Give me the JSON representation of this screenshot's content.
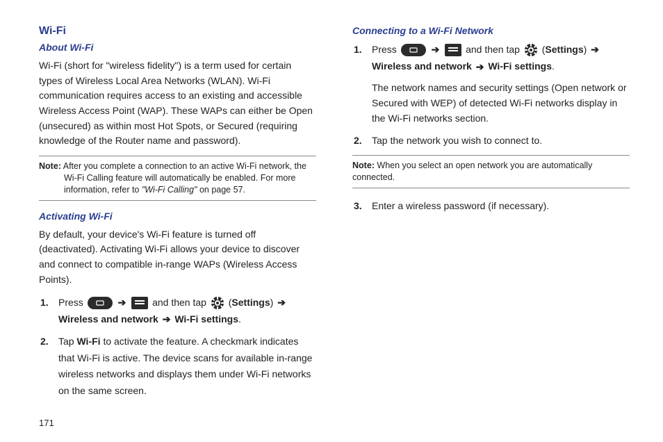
{
  "left": {
    "h1": "Wi-Fi",
    "about": {
      "heading": "About Wi-Fi",
      "body": "Wi-Fi (short for \"wireless fidelity\") is a term used for certain types of Wireless Local Area Networks (WLAN). Wi-Fi communication requires access to an existing and accessible Wireless Access Point (WAP). These WAPs can either be Open (unsecured) as within most Hot Spots, or Secured (requiring knowledge of the Router name and password)."
    },
    "note1": {
      "label": "Note:",
      "body": " After you complete a connection to an active Wi-Fi network, the Wi-Fi Calling feature will automatically be enabled. For more information, refer to ",
      "ref": "\"Wi-Fi Calling\"",
      "tail": "  on page 57."
    },
    "activating": {
      "heading": "Activating Wi-Fi",
      "body": "By default, your device's Wi-Fi feature is turned off (deactivated). Activating Wi-Fi allows your device to discover and connect to compatible in-range WAPs (Wireless Access Points).",
      "steps": [
        {
          "num": "1.",
          "pre": "Press ",
          "mid": " and then tap ",
          "settings": "Settings",
          "wn": "Wireless and network",
          "ws": "Wi-Fi settings"
        },
        {
          "num": "2.",
          "pre": "Tap ",
          "wifi": "Wi-Fi",
          "tail": " to activate the feature. A checkmark indicates that Wi-Fi is active. The device scans for available in-range wireless networks and displays them under Wi-Fi networks on the same screen."
        }
      ]
    }
  },
  "right": {
    "connecting": {
      "heading": "Connecting to a Wi-Fi Network",
      "steps": [
        {
          "num": "1.",
          "pre": "Press ",
          "mid": " and then tap ",
          "settings": "Settings",
          "wn": "Wireless and network",
          "ws": "Wi-Fi settings",
          "after": "The network names and security settings (Open network or Secured with WEP) of detected Wi-Fi networks display in the Wi-Fi networks section."
        },
        {
          "num": "2.",
          "body": "Tap the network you wish to connect to."
        }
      ]
    },
    "note2": {
      "label": "Note:",
      "body": " When you select an open network you are automatically connected."
    },
    "step3": {
      "num": "3.",
      "body": "Enter a wireless password (if necessary)."
    }
  },
  "page": "171",
  "glyphs": {
    "arrow": "➔"
  }
}
